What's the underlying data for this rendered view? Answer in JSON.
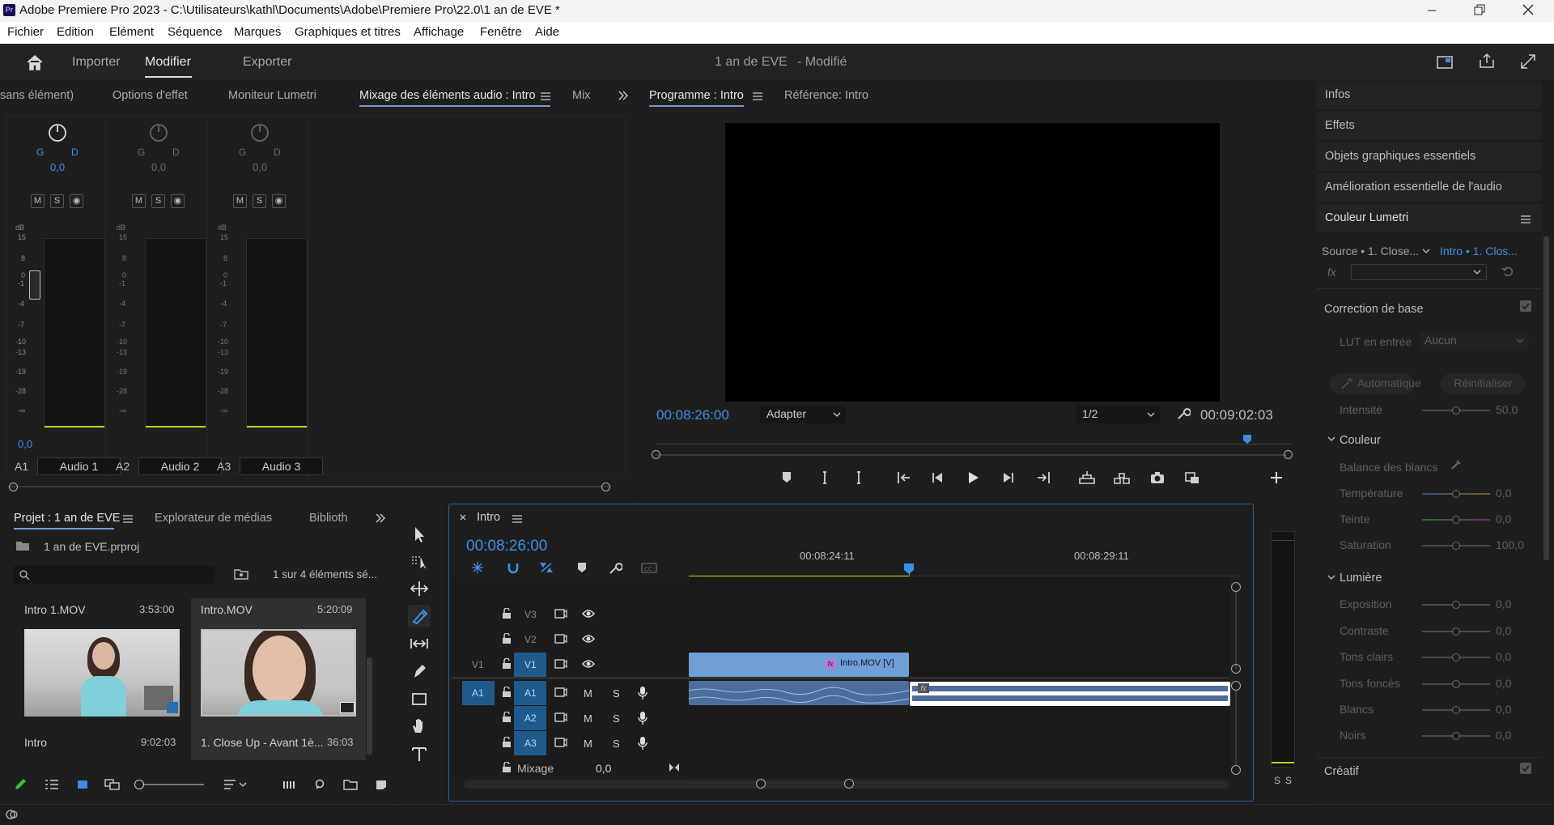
{
  "window": {
    "title": "Adobe Premiere Pro 2023 - C:\\Utilisateurs\\kathl\\Documents\\Adobe\\Premiere Pro\\22.0\\1 an de EVE *",
    "app_icon": "Pr"
  },
  "menu": [
    "Fichier",
    "Edition",
    "Elément",
    "Séquence",
    "Marques",
    "Graphiques et titres",
    "Affichage",
    "Fenêtre",
    "Aide"
  ],
  "header": {
    "tabs": [
      "Importer",
      "Modifier",
      "Exporter"
    ],
    "project_title": "1 an de EVE",
    "status": "- Modifié"
  },
  "audio_panel": {
    "tabs": [
      "sans élément)",
      "Options d'effet",
      "Moniteur Lumetri",
      "Mixage des éléments audio : Intro",
      "Mix"
    ],
    "pan_letters": "G",
    "pan_right": "D",
    "channels": [
      {
        "id": "A1",
        "name": "Audio 1",
        "pan_value": "0,0",
        "volume": "0,0",
        "active": true
      },
      {
        "id": "A2",
        "name": "Audio 2",
        "pan_value": "0,0",
        "volume": "",
        "active": false
      },
      {
        "id": "A3",
        "name": "Audio 3",
        "pan_value": "0,0",
        "volume": "",
        "active": false
      }
    ],
    "db_label": "dB",
    "db_scale": [
      "15",
      "8",
      "0",
      "-1",
      "-4",
      "-7",
      "-10",
      "-13",
      "-19",
      "-28",
      "-∞"
    ],
    "msr": [
      "M",
      "S"
    ]
  },
  "program_monitor": {
    "tabs": [
      "Programme : Intro",
      "Référence: Intro"
    ],
    "timecode_current": "00:08:26:00",
    "fit": "Adapter",
    "resolution": "1/2",
    "timecode_duration": "00:09:02:03",
    "playhead_fraction": 0.93
  },
  "right_panel": {
    "sections": [
      "Infos",
      "Effets",
      "Objets graphiques essentiels",
      "Amélioration essentielle de l'audio",
      "Couleur Lumetri"
    ],
    "source_label": "Source • 1. Close...",
    "target_label": "Intro • 1. Clos...",
    "fx_label": "fx",
    "basic_correction": "Correction de base",
    "lut_label": "LUT en entrée",
    "lut_value": "Aucun",
    "auto_btn": "Automatique",
    "reset_btn": "Réinitialiser",
    "intensity_label": "Intensité",
    "intensity_value": "50,0",
    "color_section": "Couleur",
    "white_balance": "Balance des blancs",
    "color_rows": [
      {
        "label": "Température",
        "value": "0,0"
      },
      {
        "label": "Teinte",
        "value": "0,0"
      },
      {
        "label": "Saturation",
        "value": "100,0"
      }
    ],
    "light_section": "Lumière",
    "light_rows": [
      {
        "label": "Exposition",
        "value": "0,0"
      },
      {
        "label": "Contraste",
        "value": "0,0"
      },
      {
        "label": "Tons clairs",
        "value": "0,0"
      },
      {
        "label": "Tons foncés",
        "value": "0,0"
      },
      {
        "label": "Blancs",
        "value": "0,0"
      },
      {
        "label": "Noirs",
        "value": "0,0"
      }
    ],
    "creative": "Créatif"
  },
  "project_panel": {
    "tabs": [
      "Projet : 1 an de EVE",
      "Explorateur de médias",
      "Biblioth"
    ],
    "file": "1 an de EVE.prproj",
    "count": "1 sur 4 éléments sé...",
    "items": [
      {
        "name": "Intro 1.MOV",
        "duration": "3:53:00",
        "caption": "Intro",
        "caption_duration": "9:02:03"
      },
      {
        "name": "Intro.MOV",
        "duration": "5:20:09",
        "caption": "1. Close Up - Avant 1è...",
        "caption_duration": "36:03"
      }
    ]
  },
  "timeline": {
    "tab": "Intro",
    "timecode": "00:08:26:00",
    "ruler": [
      "00:08:24:11",
      "00:08:29:11"
    ],
    "video_tracks": [
      "V3",
      "V2",
      "V1"
    ],
    "audio_tracks": [
      "A1",
      "A2",
      "A3"
    ],
    "v1_source": "V1",
    "a1_source": "A1",
    "clip_label": "Intro.MOV [V]",
    "fx_badge": "fx",
    "mix_label": "Mixage",
    "mix_value": "0,0",
    "msr": [
      "M",
      "S"
    ]
  },
  "meter": {
    "labels": [
      "S",
      "S"
    ]
  },
  "colors": {
    "accent": "#3b8ee8",
    "clip_video": "#6f9dd6",
    "clip_audio": "#4d6e9c",
    "work_area": "#d4d400"
  }
}
